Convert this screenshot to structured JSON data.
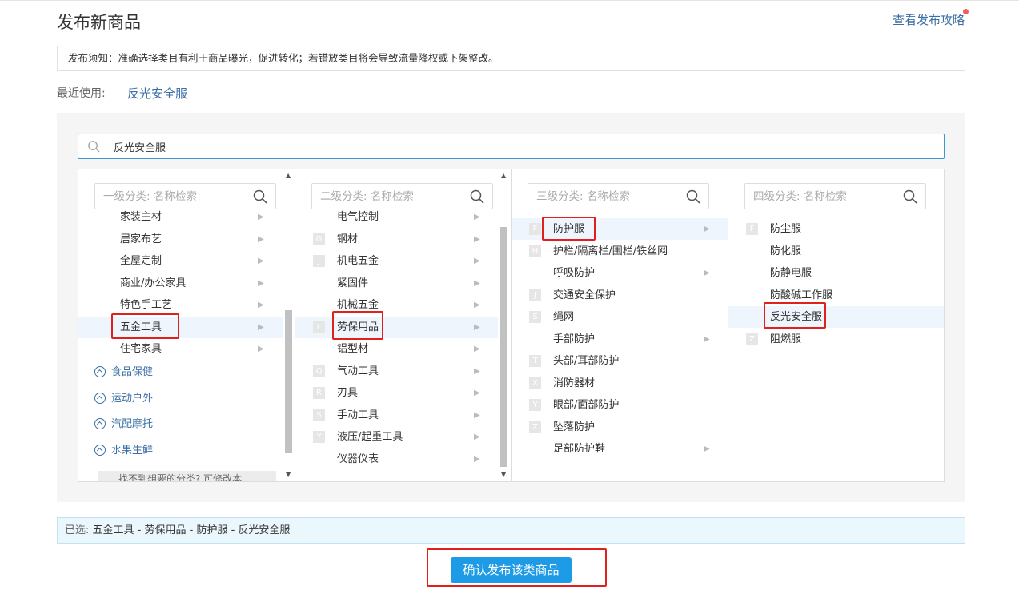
{
  "header": {
    "title": "发布新商品",
    "guide_link": "查看发布攻略"
  },
  "notice": "发布须知：准确选择类目有利于商品曝光，促进转化；若错放类目将会导致流量降权或下架整改。",
  "recent": {
    "label": "最近使用:",
    "item": "反光安全服"
  },
  "search": {
    "value": "反光安全服"
  },
  "columns": {
    "level1": {
      "placeholder": "一级分类: 名称检索",
      "items": [
        "家装主材",
        "居家布艺",
        "全屋定制",
        "商业/办公家具",
        "特色手工艺",
        "五金工具",
        "住宅家具"
      ],
      "groups": [
        "食品保健",
        "运动户外",
        "汽配摩托",
        "水果生鲜"
      ],
      "help": "找不到想要的分类? 可修改本"
    },
    "level2": {
      "placeholder": "二级分类: 名称检索",
      "items": [
        {
          "letter": "",
          "label": "电气控制"
        },
        {
          "letter": "G",
          "label": "钢材"
        },
        {
          "letter": "J",
          "label": "机电五金"
        },
        {
          "letter": "",
          "label": "紧固件"
        },
        {
          "letter": "",
          "label": "机械五金"
        },
        {
          "letter": "L",
          "label": "劳保用品"
        },
        {
          "letter": "",
          "label": "铝型材"
        },
        {
          "letter": "Q",
          "label": "气动工具"
        },
        {
          "letter": "R",
          "label": "刃具"
        },
        {
          "letter": "S",
          "label": "手动工具"
        },
        {
          "letter": "Y",
          "label": "液压/起重工具"
        },
        {
          "letter": "",
          "label": "仪器仪表"
        }
      ]
    },
    "level3": {
      "placeholder": "三级分类: 名称检索",
      "items": [
        {
          "letter": "F",
          "label": "防护服"
        },
        {
          "letter": "H",
          "label": "护栏/隔离栏/围栏/铁丝网"
        },
        {
          "letter": "",
          "label": "呼吸防护"
        },
        {
          "letter": "J",
          "label": "交通安全保护"
        },
        {
          "letter": "S",
          "label": "绳网"
        },
        {
          "letter": "",
          "label": "手部防护"
        },
        {
          "letter": "T",
          "label": "头部/耳部防护"
        },
        {
          "letter": "X",
          "label": "消防器材"
        },
        {
          "letter": "Y",
          "label": "眼部/面部防护"
        },
        {
          "letter": "Z",
          "label": "坠落防护"
        },
        {
          "letter": "",
          "label": "足部防护鞋"
        }
      ]
    },
    "level4": {
      "placeholder": "四级分类: 名称检索",
      "items": [
        {
          "letter": "F",
          "label": "防尘服"
        },
        {
          "letter": "",
          "label": "防化服"
        },
        {
          "letter": "",
          "label": "防静电服"
        },
        {
          "letter": "",
          "label": "防酸碱工作服"
        },
        {
          "letter": "",
          "label": "反光安全服"
        },
        {
          "letter": "Z",
          "label": "阻燃服"
        }
      ]
    }
  },
  "selected": {
    "label": "已选:",
    "path": "五金工具 - 劳保用品 - 防护服 - 反光安全服"
  },
  "confirm_button": "确认发布该类商品",
  "colors": {
    "accent": "#1e9be6",
    "link": "#3a6ea5",
    "highlight_box": "#e0201a",
    "selected_row": "#eef5fc"
  }
}
